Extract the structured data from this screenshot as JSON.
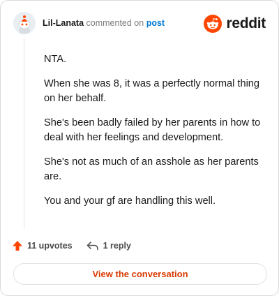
{
  "comment": {
    "username": "Lil-Lanata",
    "action_text": "commented on",
    "target_link": "post",
    "body": [
      "NTA.",
      "When she was 8, it was a perfectly normal thing on her behalf.",
      "She's been badly failed by her parents in how to deal with her feelings and development.",
      "She's not as much of an asshole as her parents are.",
      "You and your gf are handling this well."
    ]
  },
  "brand": {
    "name": "reddit",
    "icon": "reddit-logo-icon",
    "color": "#ff4500"
  },
  "actions": {
    "upvotes_label": "11 upvotes",
    "upvote_icon": "upvote-arrow-icon",
    "reply_label": "1 reply",
    "reply_icon": "reply-icon"
  },
  "footer": {
    "view_button_label": "View the conversation"
  },
  "colors": {
    "accent": "#d93a00",
    "upvote": "#ff4500",
    "link": "#0079d3"
  }
}
